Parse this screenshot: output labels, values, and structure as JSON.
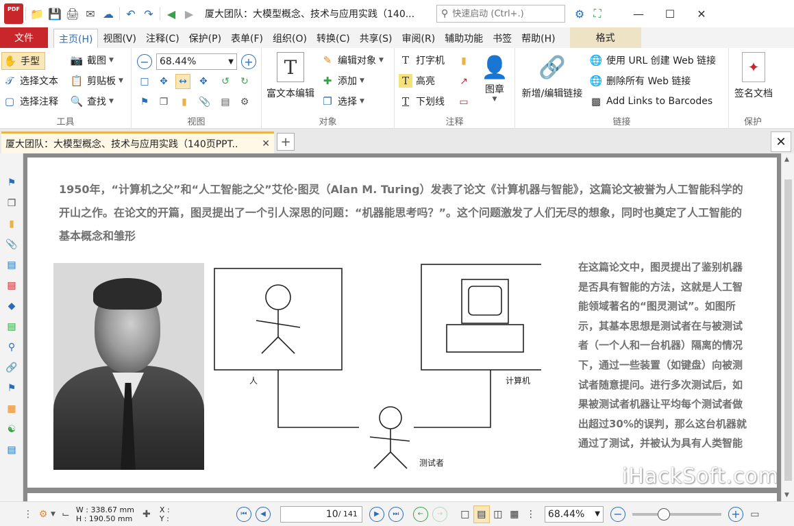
{
  "window": {
    "logo_text": "PDF",
    "title": "厦大团队：大模型概念、技术与应用实践（140...",
    "search_placeholder": "快速启动 (Ctrl+.)",
    "minimize": "—",
    "maximize": "☐",
    "close": "✕"
  },
  "menu": {
    "file": "文件",
    "items": [
      "主页(H)",
      "视图(V)",
      "注释(C)",
      "保护(P)",
      "表单(F)",
      "组织(O)",
      "转换(C)",
      "共享(S)",
      "审阅(R)",
      "辅助功能",
      "书签",
      "帮助(H)"
    ],
    "active_index": 0,
    "format": "格式"
  },
  "ribbon": {
    "tools": {
      "label": "工具",
      "hand": "手型",
      "screenshot": "截图",
      "select_text": "选择文本",
      "clipboard": "剪贴板",
      "select_annot": "选择注释",
      "find": "查找"
    },
    "view": {
      "label": "视图",
      "zoom_value": "68.44%"
    },
    "object": {
      "label": "对象",
      "rich_text": "富文本编辑",
      "edit_object": "编辑对象",
      "add": "添加",
      "select": "选择"
    },
    "comment": {
      "label": "注释",
      "typewriter": "打字机",
      "highlight": "高亮",
      "underline": "下划线",
      "stamp": "图章"
    },
    "link": {
      "label": "链接",
      "new_edit": "新增/编辑链接",
      "create_web": "使用 URL 创建 Web 链接",
      "delete_web": "删除所有 Web 链接",
      "barcodes": "Add Links to Barcodes"
    },
    "protect": {
      "label": "保护",
      "sign": "签名文档"
    }
  },
  "tabs": {
    "doc_title": "厦大团队：大模型概念、技术与应用实践（140页PPT..",
    "close": "✕",
    "add": "+",
    "close_all": "✕"
  },
  "document": {
    "intro": "1950年，“计算机之父”和“人工智能之父”艾伦·图灵（Alan M. Turing）发表了论文《计算机器与智能》，这篇论文被誉为人工智能科学的开山之作。在论文的开篇，图灵提出了一个引人深思的问题：“机器能思考吗？”。这个问题激发了人们无尽的想象，同时也奠定了人工智能的基本概念和雏形",
    "diagram": {
      "human_label": "人",
      "computer_label": "计算机",
      "tester_label": "测试者"
    },
    "side_text": "在这篇论文中，图灵提出了鉴别机器是否具有智能的方法，这就是人工智能领域著名的“图灵测试”。如图所示，其基本思想是测试者在与被测试者（一个人和一台机器）隔离的情况下，通过一些装置（如键盘）向被测试者随意提问。进行多次测试后，如果被测试者机器让平均每个测试者做出超过30%的误判，那么这台机器就通过了测试，并被认为具有人类智能",
    "watermark": "iHackSoft.com"
  },
  "status": {
    "width": "W : 338.67 mm",
    "height": "H : 190.50 mm",
    "x": "X :",
    "y": "Y :",
    "current_page": "10",
    "total_pages": "/ 141",
    "zoom": "68.44%",
    "zoom_fraction": 0.35
  },
  "colors": {
    "accent_red": "#c8262b",
    "accent_blue": "#2a6db5",
    "highlight": "#f9e7b7",
    "text_gray": "#707070"
  }
}
